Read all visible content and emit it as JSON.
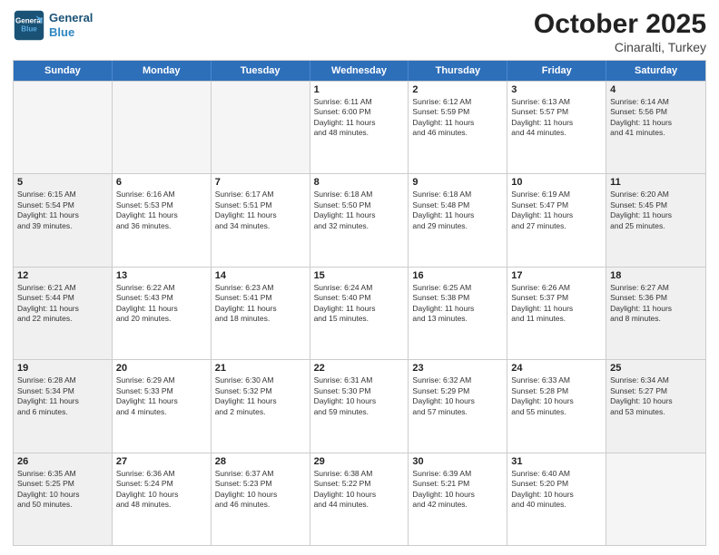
{
  "header": {
    "logo_line1": "General",
    "logo_line2": "Blue",
    "month": "October 2025",
    "location": "Cinaralti, Turkey"
  },
  "weekdays": [
    "Sunday",
    "Monday",
    "Tuesday",
    "Wednesday",
    "Thursday",
    "Friday",
    "Saturday"
  ],
  "rows": [
    [
      {
        "day": "",
        "text": "",
        "empty": true
      },
      {
        "day": "",
        "text": "",
        "empty": true
      },
      {
        "day": "",
        "text": "",
        "empty": true
      },
      {
        "day": "1",
        "text": "Sunrise: 6:11 AM\nSunset: 6:00 PM\nDaylight: 11 hours\nand 48 minutes.",
        "empty": false
      },
      {
        "day": "2",
        "text": "Sunrise: 6:12 AM\nSunset: 5:59 PM\nDaylight: 11 hours\nand 46 minutes.",
        "empty": false
      },
      {
        "day": "3",
        "text": "Sunrise: 6:13 AM\nSunset: 5:57 PM\nDaylight: 11 hours\nand 44 minutes.",
        "empty": false
      },
      {
        "day": "4",
        "text": "Sunrise: 6:14 AM\nSunset: 5:56 PM\nDaylight: 11 hours\nand 41 minutes.",
        "empty": false,
        "shaded": true
      }
    ],
    [
      {
        "day": "5",
        "text": "Sunrise: 6:15 AM\nSunset: 5:54 PM\nDaylight: 11 hours\nand 39 minutes.",
        "empty": false,
        "shaded": true
      },
      {
        "day": "6",
        "text": "Sunrise: 6:16 AM\nSunset: 5:53 PM\nDaylight: 11 hours\nand 36 minutes.",
        "empty": false
      },
      {
        "day": "7",
        "text": "Sunrise: 6:17 AM\nSunset: 5:51 PM\nDaylight: 11 hours\nand 34 minutes.",
        "empty": false
      },
      {
        "day": "8",
        "text": "Sunrise: 6:18 AM\nSunset: 5:50 PM\nDaylight: 11 hours\nand 32 minutes.",
        "empty": false
      },
      {
        "day": "9",
        "text": "Sunrise: 6:18 AM\nSunset: 5:48 PM\nDaylight: 11 hours\nand 29 minutes.",
        "empty": false
      },
      {
        "day": "10",
        "text": "Sunrise: 6:19 AM\nSunset: 5:47 PM\nDaylight: 11 hours\nand 27 minutes.",
        "empty": false
      },
      {
        "day": "11",
        "text": "Sunrise: 6:20 AM\nSunset: 5:45 PM\nDaylight: 11 hours\nand 25 minutes.",
        "empty": false,
        "shaded": true
      }
    ],
    [
      {
        "day": "12",
        "text": "Sunrise: 6:21 AM\nSunset: 5:44 PM\nDaylight: 11 hours\nand 22 minutes.",
        "empty": false,
        "shaded": true
      },
      {
        "day": "13",
        "text": "Sunrise: 6:22 AM\nSunset: 5:43 PM\nDaylight: 11 hours\nand 20 minutes.",
        "empty": false
      },
      {
        "day": "14",
        "text": "Sunrise: 6:23 AM\nSunset: 5:41 PM\nDaylight: 11 hours\nand 18 minutes.",
        "empty": false
      },
      {
        "day": "15",
        "text": "Sunrise: 6:24 AM\nSunset: 5:40 PM\nDaylight: 11 hours\nand 15 minutes.",
        "empty": false
      },
      {
        "day": "16",
        "text": "Sunrise: 6:25 AM\nSunset: 5:38 PM\nDaylight: 11 hours\nand 13 minutes.",
        "empty": false
      },
      {
        "day": "17",
        "text": "Sunrise: 6:26 AM\nSunset: 5:37 PM\nDaylight: 11 hours\nand 11 minutes.",
        "empty": false
      },
      {
        "day": "18",
        "text": "Sunrise: 6:27 AM\nSunset: 5:36 PM\nDaylight: 11 hours\nand 8 minutes.",
        "empty": false,
        "shaded": true
      }
    ],
    [
      {
        "day": "19",
        "text": "Sunrise: 6:28 AM\nSunset: 5:34 PM\nDaylight: 11 hours\nand 6 minutes.",
        "empty": false,
        "shaded": true
      },
      {
        "day": "20",
        "text": "Sunrise: 6:29 AM\nSunset: 5:33 PM\nDaylight: 11 hours\nand 4 minutes.",
        "empty": false
      },
      {
        "day": "21",
        "text": "Sunrise: 6:30 AM\nSunset: 5:32 PM\nDaylight: 11 hours\nand 2 minutes.",
        "empty": false
      },
      {
        "day": "22",
        "text": "Sunrise: 6:31 AM\nSunset: 5:30 PM\nDaylight: 10 hours\nand 59 minutes.",
        "empty": false
      },
      {
        "day": "23",
        "text": "Sunrise: 6:32 AM\nSunset: 5:29 PM\nDaylight: 10 hours\nand 57 minutes.",
        "empty": false
      },
      {
        "day": "24",
        "text": "Sunrise: 6:33 AM\nSunset: 5:28 PM\nDaylight: 10 hours\nand 55 minutes.",
        "empty": false
      },
      {
        "day": "25",
        "text": "Sunrise: 6:34 AM\nSunset: 5:27 PM\nDaylight: 10 hours\nand 53 minutes.",
        "empty": false,
        "shaded": true
      }
    ],
    [
      {
        "day": "26",
        "text": "Sunrise: 6:35 AM\nSunset: 5:25 PM\nDaylight: 10 hours\nand 50 minutes.",
        "empty": false,
        "shaded": true
      },
      {
        "day": "27",
        "text": "Sunrise: 6:36 AM\nSunset: 5:24 PM\nDaylight: 10 hours\nand 48 minutes.",
        "empty": false
      },
      {
        "day": "28",
        "text": "Sunrise: 6:37 AM\nSunset: 5:23 PM\nDaylight: 10 hours\nand 46 minutes.",
        "empty": false
      },
      {
        "day": "29",
        "text": "Sunrise: 6:38 AM\nSunset: 5:22 PM\nDaylight: 10 hours\nand 44 minutes.",
        "empty": false
      },
      {
        "day": "30",
        "text": "Sunrise: 6:39 AM\nSunset: 5:21 PM\nDaylight: 10 hours\nand 42 minutes.",
        "empty": false
      },
      {
        "day": "31",
        "text": "Sunrise: 6:40 AM\nSunset: 5:20 PM\nDaylight: 10 hours\nand 40 minutes.",
        "empty": false
      },
      {
        "day": "",
        "text": "",
        "empty": true,
        "shaded": true
      }
    ]
  ]
}
